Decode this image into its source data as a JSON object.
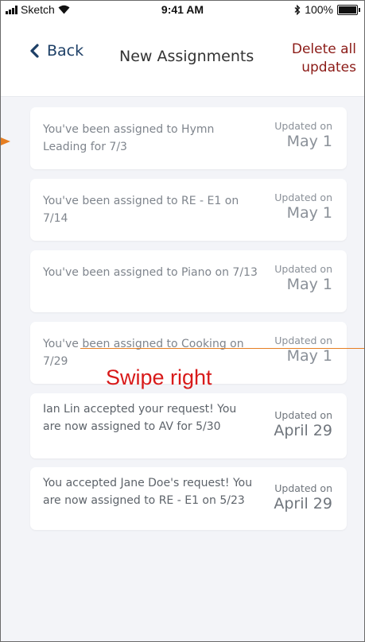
{
  "status_bar": {
    "carrier": "Sketch",
    "time": "9:41 AM",
    "battery": "100%"
  },
  "nav": {
    "back_label": "Back",
    "title": "New Assignments",
    "action_label": "Delete all updates"
  },
  "cards": [
    {
      "message": "You've been assigned to Hymn Leading for 7/3",
      "updated_label": "Updated on",
      "date": "May 1"
    },
    {
      "message": "You've been assigned to RE - E1 on 7/14",
      "updated_label": "Updated on",
      "date": "May 1"
    },
    {
      "message": "You've been assigned to Piano on 7/13",
      "updated_label": "Updated on",
      "date": "May 1"
    },
    {
      "message": "You've been assigned to Cooking on 7/29",
      "updated_label": "Updated on",
      "date": "May 1"
    },
    {
      "message": "Ian Lin accepted your request! You are now assigned to AV for 5/30",
      "updated_label": "Updated on",
      "date": "April 29"
    },
    {
      "message": "You accepted Jane Doe's request! You are now assigned to RE - E1 on 5/23",
      "updated_label": "Updated on",
      "date": "April 29"
    }
  ],
  "annotation": {
    "swipe_label": "Swipe right"
  },
  "colors": {
    "back": "#1d3f66",
    "delete_action": "#8b1a16",
    "swipe_label": "#d81a1a",
    "swipe_line": "#e67e22",
    "list_background": "#f3f4f8"
  }
}
